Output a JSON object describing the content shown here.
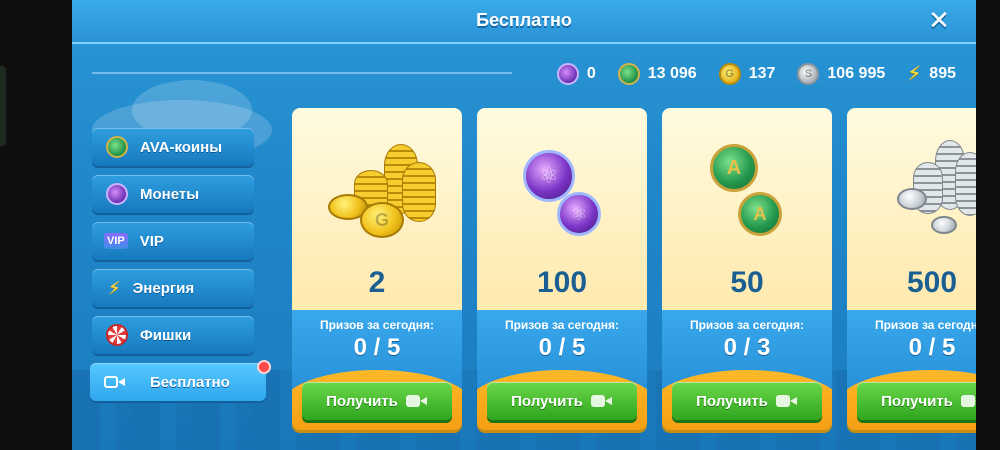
{
  "window": {
    "title": "Бесплатно",
    "close_glyph": "✕"
  },
  "currencies": [
    {
      "icon": "atom-coin-icon",
      "value": "0"
    },
    {
      "icon": "ava-coin-icon",
      "value": "13 096"
    },
    {
      "icon": "gold-coin-icon",
      "value": "137"
    },
    {
      "icon": "silver-coin-icon",
      "value": "106 995"
    },
    {
      "icon": "energy-bolt-icon",
      "value": "895"
    }
  ],
  "sidebar": {
    "items": [
      {
        "label": "AVA-коины",
        "icon": "ava-coin-icon"
      },
      {
        "label": "Монеты",
        "icon": "atom-coin-icon"
      },
      {
        "label": "VIP",
        "icon": "vip-icon",
        "icon_text": "VIP"
      },
      {
        "label": "Энергия",
        "icon": "energy-bolt-icon"
      },
      {
        "label": "Фишки",
        "icon": "poker-chip-icon"
      },
      {
        "label": "Бесплатно",
        "icon": "video-camera-icon",
        "active": true,
        "has_notification": true
      }
    ]
  },
  "cards": [
    {
      "reward_type": "gold-coins",
      "amount": "2",
      "prizes_label": "Призов за сегодня:",
      "prizes_value": "0 / 5",
      "button_label": "Получить"
    },
    {
      "reward_type": "atom-coins",
      "amount": "100",
      "prizes_label": "Призов за сегодня:",
      "prizes_value": "0 / 5",
      "button_label": "Получить"
    },
    {
      "reward_type": "ava-coins",
      "amount": "50",
      "prizes_label": "Призов за сегодня:",
      "prizes_value": "0 / 3",
      "button_label": "Получить"
    },
    {
      "reward_type": "silver-coins",
      "amount": "500",
      "prizes_label": "Призов за сегодня:",
      "prizes_value": "0 / 5",
      "button_label": "Получить"
    }
  ],
  "colors": {
    "panel_blue": "#1f86c9",
    "card_cream": "#ffeab0",
    "button_green": "#2ea51f",
    "amount_text": "#1b5f92",
    "notification_red": "#ff4848"
  }
}
